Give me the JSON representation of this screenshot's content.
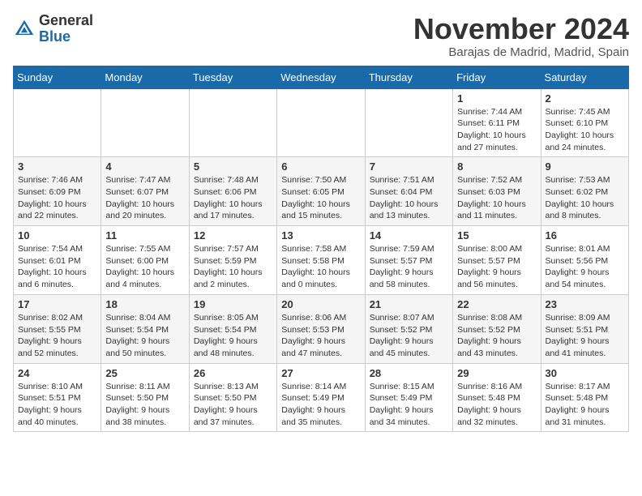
{
  "logo": {
    "general": "General",
    "blue": "Blue"
  },
  "title": {
    "month": "November 2024",
    "location": "Barajas de Madrid, Madrid, Spain"
  },
  "headers": [
    "Sunday",
    "Monday",
    "Tuesday",
    "Wednesday",
    "Thursday",
    "Friday",
    "Saturday"
  ],
  "weeks": [
    [
      {
        "day": "",
        "info": ""
      },
      {
        "day": "",
        "info": ""
      },
      {
        "day": "",
        "info": ""
      },
      {
        "day": "",
        "info": ""
      },
      {
        "day": "",
        "info": ""
      },
      {
        "day": "1",
        "info": "Sunrise: 7:44 AM\nSunset: 6:11 PM\nDaylight: 10 hours and 27 minutes."
      },
      {
        "day": "2",
        "info": "Sunrise: 7:45 AM\nSunset: 6:10 PM\nDaylight: 10 hours and 24 minutes."
      }
    ],
    [
      {
        "day": "3",
        "info": "Sunrise: 7:46 AM\nSunset: 6:09 PM\nDaylight: 10 hours and 22 minutes."
      },
      {
        "day": "4",
        "info": "Sunrise: 7:47 AM\nSunset: 6:07 PM\nDaylight: 10 hours and 20 minutes."
      },
      {
        "day": "5",
        "info": "Sunrise: 7:48 AM\nSunset: 6:06 PM\nDaylight: 10 hours and 17 minutes."
      },
      {
        "day": "6",
        "info": "Sunrise: 7:50 AM\nSunset: 6:05 PM\nDaylight: 10 hours and 15 minutes."
      },
      {
        "day": "7",
        "info": "Sunrise: 7:51 AM\nSunset: 6:04 PM\nDaylight: 10 hours and 13 minutes."
      },
      {
        "day": "8",
        "info": "Sunrise: 7:52 AM\nSunset: 6:03 PM\nDaylight: 10 hours and 11 minutes."
      },
      {
        "day": "9",
        "info": "Sunrise: 7:53 AM\nSunset: 6:02 PM\nDaylight: 10 hours and 8 minutes."
      }
    ],
    [
      {
        "day": "10",
        "info": "Sunrise: 7:54 AM\nSunset: 6:01 PM\nDaylight: 10 hours and 6 minutes."
      },
      {
        "day": "11",
        "info": "Sunrise: 7:55 AM\nSunset: 6:00 PM\nDaylight: 10 hours and 4 minutes."
      },
      {
        "day": "12",
        "info": "Sunrise: 7:57 AM\nSunset: 5:59 PM\nDaylight: 10 hours and 2 minutes."
      },
      {
        "day": "13",
        "info": "Sunrise: 7:58 AM\nSunset: 5:58 PM\nDaylight: 10 hours and 0 minutes."
      },
      {
        "day": "14",
        "info": "Sunrise: 7:59 AM\nSunset: 5:57 PM\nDaylight: 9 hours and 58 minutes."
      },
      {
        "day": "15",
        "info": "Sunrise: 8:00 AM\nSunset: 5:57 PM\nDaylight: 9 hours and 56 minutes."
      },
      {
        "day": "16",
        "info": "Sunrise: 8:01 AM\nSunset: 5:56 PM\nDaylight: 9 hours and 54 minutes."
      }
    ],
    [
      {
        "day": "17",
        "info": "Sunrise: 8:02 AM\nSunset: 5:55 PM\nDaylight: 9 hours and 52 minutes."
      },
      {
        "day": "18",
        "info": "Sunrise: 8:04 AM\nSunset: 5:54 PM\nDaylight: 9 hours and 50 minutes."
      },
      {
        "day": "19",
        "info": "Sunrise: 8:05 AM\nSunset: 5:54 PM\nDaylight: 9 hours and 48 minutes."
      },
      {
        "day": "20",
        "info": "Sunrise: 8:06 AM\nSunset: 5:53 PM\nDaylight: 9 hours and 47 minutes."
      },
      {
        "day": "21",
        "info": "Sunrise: 8:07 AM\nSunset: 5:52 PM\nDaylight: 9 hours and 45 minutes."
      },
      {
        "day": "22",
        "info": "Sunrise: 8:08 AM\nSunset: 5:52 PM\nDaylight: 9 hours and 43 minutes."
      },
      {
        "day": "23",
        "info": "Sunrise: 8:09 AM\nSunset: 5:51 PM\nDaylight: 9 hours and 41 minutes."
      }
    ],
    [
      {
        "day": "24",
        "info": "Sunrise: 8:10 AM\nSunset: 5:51 PM\nDaylight: 9 hours and 40 minutes."
      },
      {
        "day": "25",
        "info": "Sunrise: 8:11 AM\nSunset: 5:50 PM\nDaylight: 9 hours and 38 minutes."
      },
      {
        "day": "26",
        "info": "Sunrise: 8:13 AM\nSunset: 5:50 PM\nDaylight: 9 hours and 37 minutes."
      },
      {
        "day": "27",
        "info": "Sunrise: 8:14 AM\nSunset: 5:49 PM\nDaylight: 9 hours and 35 minutes."
      },
      {
        "day": "28",
        "info": "Sunrise: 8:15 AM\nSunset: 5:49 PM\nDaylight: 9 hours and 34 minutes."
      },
      {
        "day": "29",
        "info": "Sunrise: 8:16 AM\nSunset: 5:48 PM\nDaylight: 9 hours and 32 minutes."
      },
      {
        "day": "30",
        "info": "Sunrise: 8:17 AM\nSunset: 5:48 PM\nDaylight: 9 hours and 31 minutes."
      }
    ]
  ]
}
